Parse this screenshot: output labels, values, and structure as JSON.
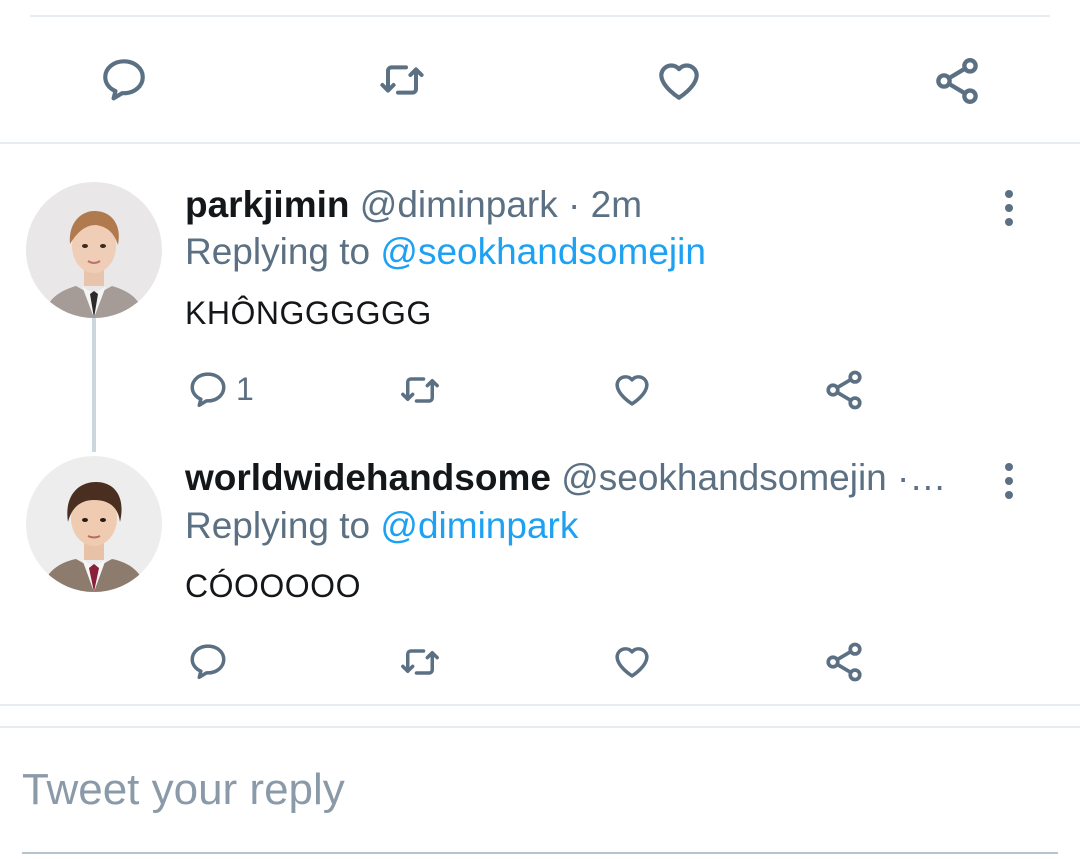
{
  "top_actions": {
    "icons": [
      "reply-icon",
      "retweet-icon",
      "like-icon",
      "share-icon"
    ]
  },
  "tweets": [
    {
      "display_name": "parkjimin",
      "handle_time": "@diminpark · 2m",
      "replying_prefix": "Replying to",
      "replying_to": "@seokhandsomejin",
      "text": "KHÔNGGGGGG",
      "reply_count": "1",
      "avatar": "avatar-parkjimin"
    },
    {
      "display_name": "worldwidehandsome",
      "handle_time": "@seokhandsomejin ·…",
      "replying_prefix": "Replying to",
      "replying_to": "@diminpark",
      "text": "CÓOOOOO",
      "reply_count": "",
      "avatar": "avatar-worldwidehandsome"
    }
  ],
  "composer": {
    "placeholder": "Tweet your reply"
  },
  "colors": {
    "accent": "#1da1f2",
    "secondary_text": "#5b7083",
    "divider": "#e6ecf0"
  }
}
